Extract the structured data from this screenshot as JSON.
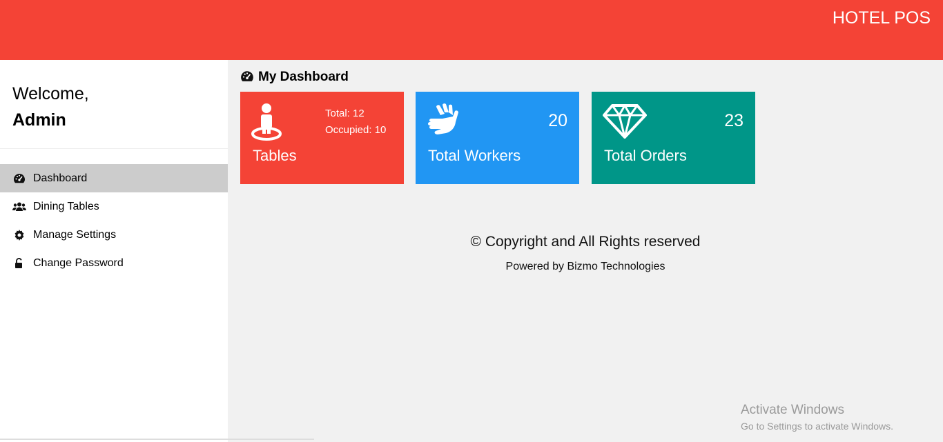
{
  "header": {
    "brand": "HOTEL POS",
    "color": "#f44336"
  },
  "sidebar": {
    "welcome": "Welcome,",
    "user": "Admin",
    "items": [
      {
        "label": "Dashboard",
        "icon": "dashboard-icon",
        "active": true
      },
      {
        "label": "Dining Tables",
        "icon": "users-icon",
        "active": false
      },
      {
        "label": "Manage Settings",
        "icon": "gear-icon",
        "active": false
      },
      {
        "label": "Change Password",
        "icon": "unlock-icon",
        "active": false
      }
    ]
  },
  "main": {
    "title": "My Dashboard",
    "cards": [
      {
        "label": "Tables",
        "icon": "person-standing-icon",
        "color": "#f44336",
        "total": "Total: 12",
        "occupied": "Occupied: 10"
      },
      {
        "label": "Total Workers",
        "icon": "hands-icon",
        "color": "#2196f3",
        "count": "20"
      },
      {
        "label": "Total Orders",
        "icon": "diamond-icon",
        "color": "#009688",
        "count": "23"
      }
    ]
  },
  "footer": {
    "copyright": "© Copyright and All Rights reserved",
    "powered": "Powered by Bizmo Technologies"
  },
  "watermark": {
    "title": "Activate Windows",
    "subtitle": "Go to Settings to activate Windows."
  }
}
